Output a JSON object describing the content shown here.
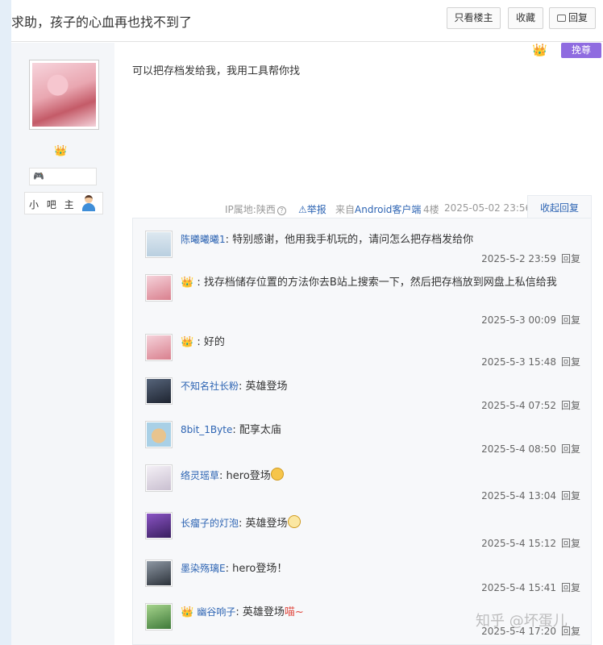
{
  "thread": {
    "title": "求助，孩子的心血再也找不到了",
    "buttons": {
      "only_op": "只看楼主",
      "favorite": "收藏",
      "reply": "回复"
    }
  },
  "author": {
    "moderator_label": "小 吧 主"
  },
  "badges": {
    "tag": "挽尊"
  },
  "post": {
    "content": "可以把存档发给我，我用工具帮你找",
    "ip": "IP属地:陕西",
    "report": "举报",
    "client_prefix": "来自",
    "client_link": "Android客户端",
    "floor": "4楼",
    "time": "2025-05-02 23:56",
    "collapse": "收起回复"
  },
  "replies": [
    {
      "user": "陈曦曦曦1",
      "text": "特别感谢，他用我手机玩的，请问怎么把存档发给你",
      "time": "2025-5-2 23:59",
      "reply": "回复",
      "avatar_color": "#c9dbe8"
    },
    {
      "user": "",
      "text": "找存档储存位置的方法你去B站上搜索一下，然后把存档放到网盘上私信给我",
      "time": "2025-5-3 00:09",
      "reply": "回复",
      "avatar_color": "#e7a9b4"
    },
    {
      "user": "",
      "text": "好的",
      "time": "2025-5-3 15:48",
      "reply": "回复",
      "avatar_color": "#e7a9b4"
    },
    {
      "user": "不知名社长粉",
      "text": "英雄登场",
      "time": "2025-5-4 07:52",
      "reply": "回复",
      "avatar_color": "#3b4658"
    },
    {
      "user": "8bit_1Byte",
      "text": "配享太庙",
      "time": "2025-5-4 08:50",
      "reply": "回复",
      "avatar_color": "#d9b17a"
    },
    {
      "user": "络灵瑶草",
      "text": "hero登场",
      "time": "2025-5-4 13:04",
      "reply": "回复",
      "avatar_color": "#ece6ef"
    },
    {
      "user": "长瘤子的灯泡",
      "text": "英雄登场",
      "time": "2025-5-4 15:12",
      "reply": "回复",
      "avatar_color": "#6b3aa0"
    },
    {
      "user": "墨染殇璃E",
      "text": "hero登场！",
      "time": "2025-5-4 15:41",
      "reply": "回复",
      "avatar_color": "#5a6470"
    },
    {
      "user": "幽谷响子",
      "text": "英雄登场",
      "suffix": "喵~",
      "time": "2025-5-4 17:20",
      "reply": "回复",
      "avatar_color": "#7cb36a"
    }
  ],
  "watermark": "知乎 @坏蛋儿"
}
